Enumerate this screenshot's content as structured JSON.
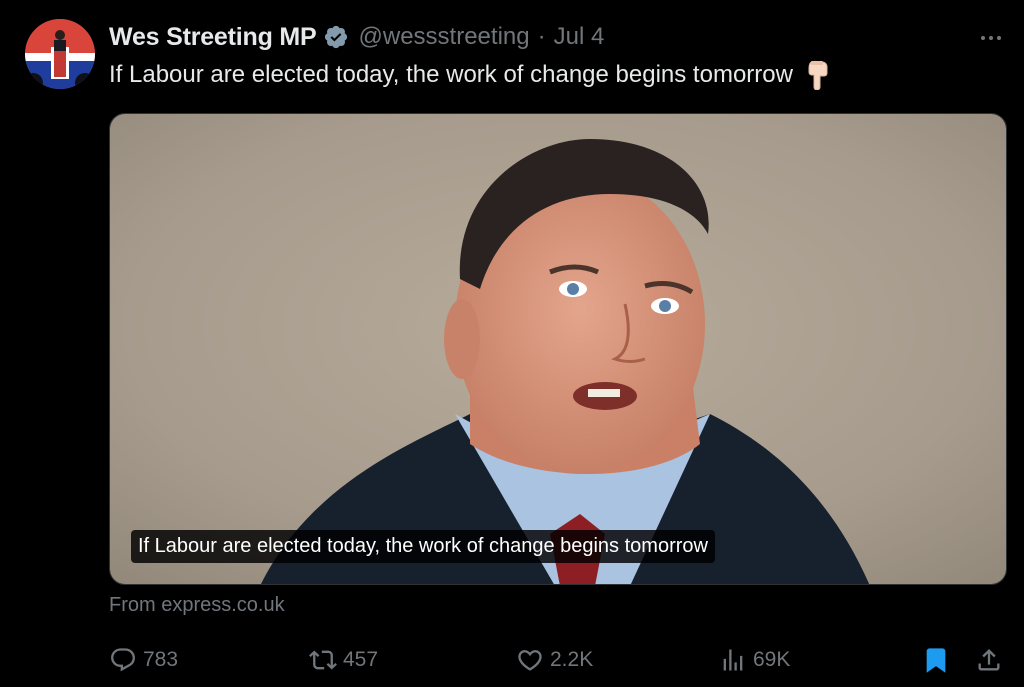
{
  "author": {
    "display_name": "Wes Streeting MP",
    "handle": "@wessstreeting",
    "separator": "·",
    "date": "Jul 4",
    "verified": true
  },
  "tweet": {
    "text": "If Labour are elected today, the work of change begins tomorrow",
    "emoji": "pointing-down-hand-icon"
  },
  "media": {
    "caption": "If Labour are elected today, the work of change begins tomorrow",
    "source": "From express.co.uk"
  },
  "actions": {
    "reply_count": "783",
    "retweet_count": "457",
    "like_count": "2.2K",
    "views_count": "69K",
    "bookmarked": true
  },
  "colors": {
    "background": "#000000",
    "text_primary": "#e7e9ea",
    "text_secondary": "#71767b",
    "verified_badge": "#829aab",
    "bookmark_active": "#1d9bf0"
  }
}
